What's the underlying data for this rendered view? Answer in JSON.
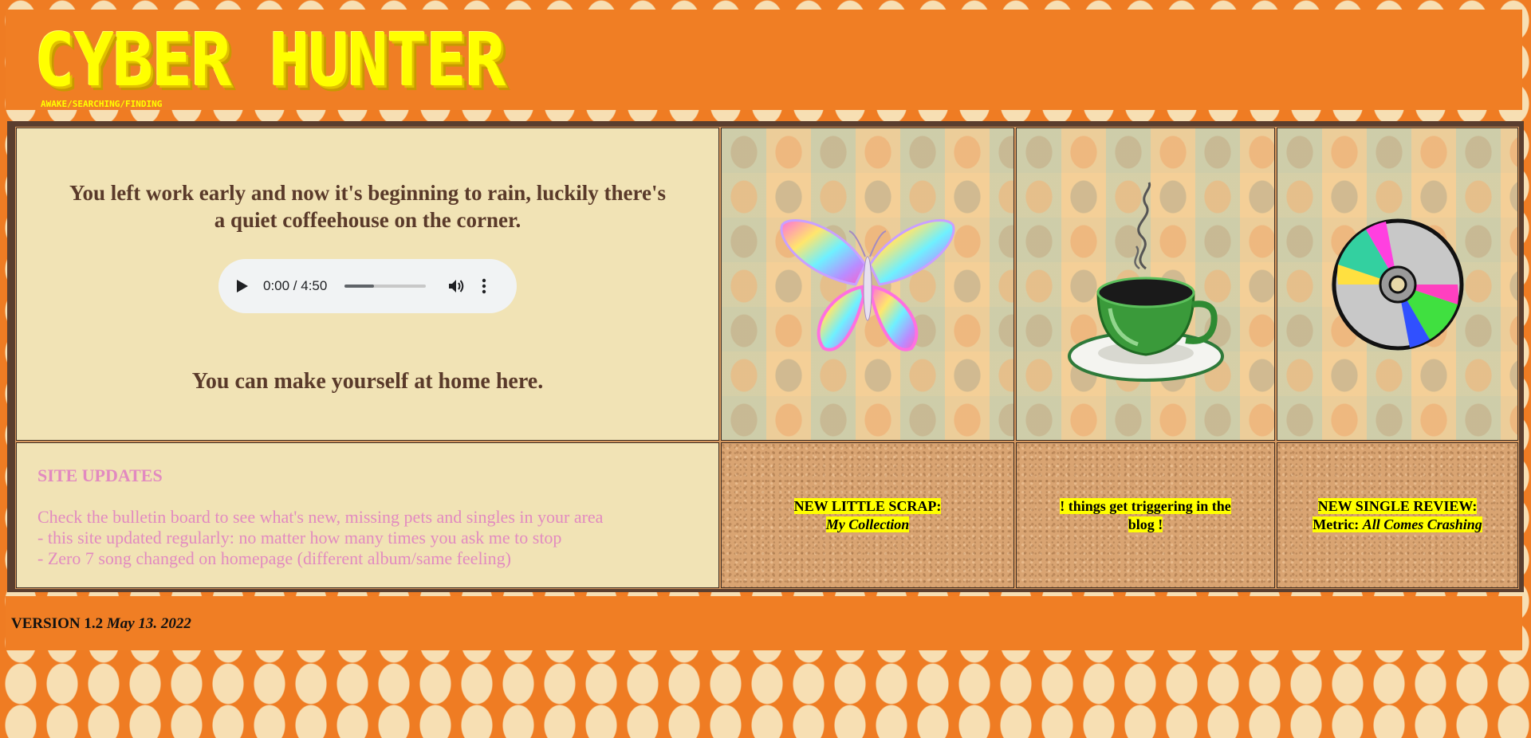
{
  "header": {
    "logo": "CYBER HUNTER",
    "tagline": "AWAKE/SEARCHING/FINDING"
  },
  "intro": {
    "heading": "You left work early and now it's beginning to rain, luckily there's a quiet coffeehouse on the corner.",
    "audio": {
      "time": "0:00 / 4:50",
      "progress": 0.36
    },
    "welcome": "You can make yourself at home here."
  },
  "images": {
    "butterfly": "butterfly-image",
    "coffee": "coffee-cup-image",
    "cd": "cd-disc-image"
  },
  "updates": {
    "title": "SITE UPDATES",
    "lines": [
      "Check the bulletin board to see what's new, missing pets and singles in your area",
      "- this site updated regularly: no matter how many times you ask me to stop",
      "- Zero 7 song changed on homepage (different album/same feeling)"
    ]
  },
  "notes": {
    "scrap_line1": "NEW LITTLE SCRAP:",
    "scrap_line2": "My Collection",
    "blog_line1": "! things get triggering in the",
    "blog_line2": "blog !",
    "review_line1": "NEW SINGLE REVIEW:",
    "review_line2a": "Metric: ",
    "review_line2b": "All Comes Crashing"
  },
  "footer": {
    "version": "VERSION 1.2",
    "date": "May 13. 2022"
  },
  "colors": {
    "orange": "#f07e24",
    "yellow": "#ffff00",
    "cream": "#f1e3b5",
    "brown": "#5a3a2a",
    "pink": "#e28ac0"
  }
}
